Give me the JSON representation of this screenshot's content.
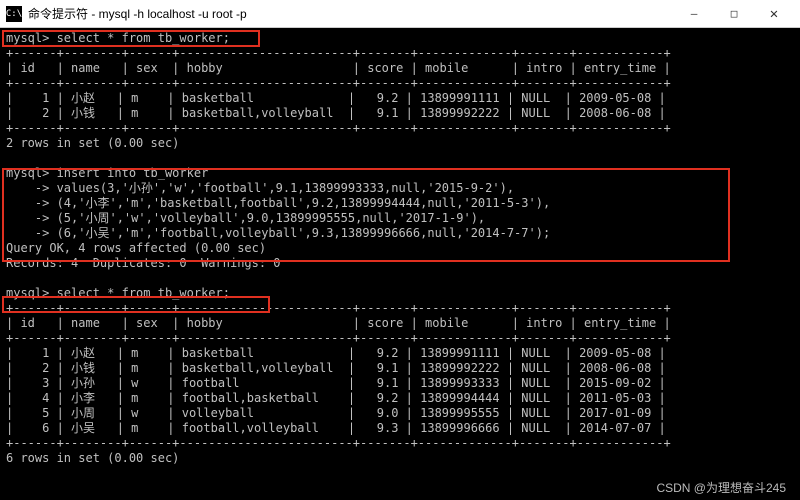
{
  "titlebar": {
    "icon_label": "C:\\",
    "title": "命令提示符 - mysql  -h localhost -u root -p",
    "minimize": "—",
    "maximize": "□",
    "close": "✕"
  },
  "queries": {
    "q1_prompt": "mysql> select * from tb_worker;",
    "q1_border_top": "+------+--------+------+------------------------+-------+-------------+-------+------------+",
    "q1_header": "| id   | name   | sex  | hobby                  | score | mobile      | intro | entry_time |",
    "q1_rows": [
      "|    1 | 小赵   | m    | basketball             |   9.2 | 13899991111 | NULL  | 2009-05-08 |",
      "|    2 | 小钱   | m    | basketball,volleyball  |   9.1 | 13899992222 | NULL  | 2008-06-08 |"
    ],
    "q1_result": "2 rows in set (0.00 sec)",
    "insert_lines": [
      "mysql> insert into tb_worker",
      "    -> values(3,'小孙','w','football',9.1,13899993333,null,'2015-9-2'),",
      "    -> (4,'小李','m','basketball,football',9.2,13899994444,null,'2011-5-3'),",
      "    -> (5,'小周','w','volleyball',9.0,13899995555,null,'2017-1-9'),",
      "    -> (6,'小吴','m','football,volleyball',9.3,13899996666,null,'2014-7-7');"
    ],
    "insert_ok": "Query OK, 4 rows affected (0.00 sec)",
    "insert_rec": "Records: 4  Duplicates: 0  Warnings: 0",
    "q2_prompt": "mysql> select * from tb_worker;",
    "q2_border_top": "+------+--------+------+------------------------+-------+-------------+-------+------------+",
    "q2_header": "| id   | name   | sex  | hobby                  | score | mobile      | intro | entry_time |",
    "q2_rows": [
      "|    1 | 小赵   | m    | basketball             |   9.2 | 13899991111 | NULL  | 2009-05-08 |",
      "|    2 | 小钱   | m    | basketball,volleyball  |   9.1 | 13899992222 | NULL  | 2008-06-08 |",
      "|    3 | 小孙   | w    | football               |   9.1 | 13899993333 | NULL  | 2015-09-02 |",
      "|    4 | 小李   | m    | football,basketball    |   9.2 | 13899994444 | NULL  | 2011-05-03 |",
      "|    5 | 小周   | w    | volleyball             |   9.0 | 13899995555 | NULL  | 2017-01-09 |",
      "|    6 | 小吴   | m    | football,volleyball    |   9.3 | 13899996666 | NULL  | 2014-07-07 |"
    ],
    "q2_result": "6 rows in set (0.00 sec)"
  },
  "watermark": "CSDN @为理想奋斗245"
}
